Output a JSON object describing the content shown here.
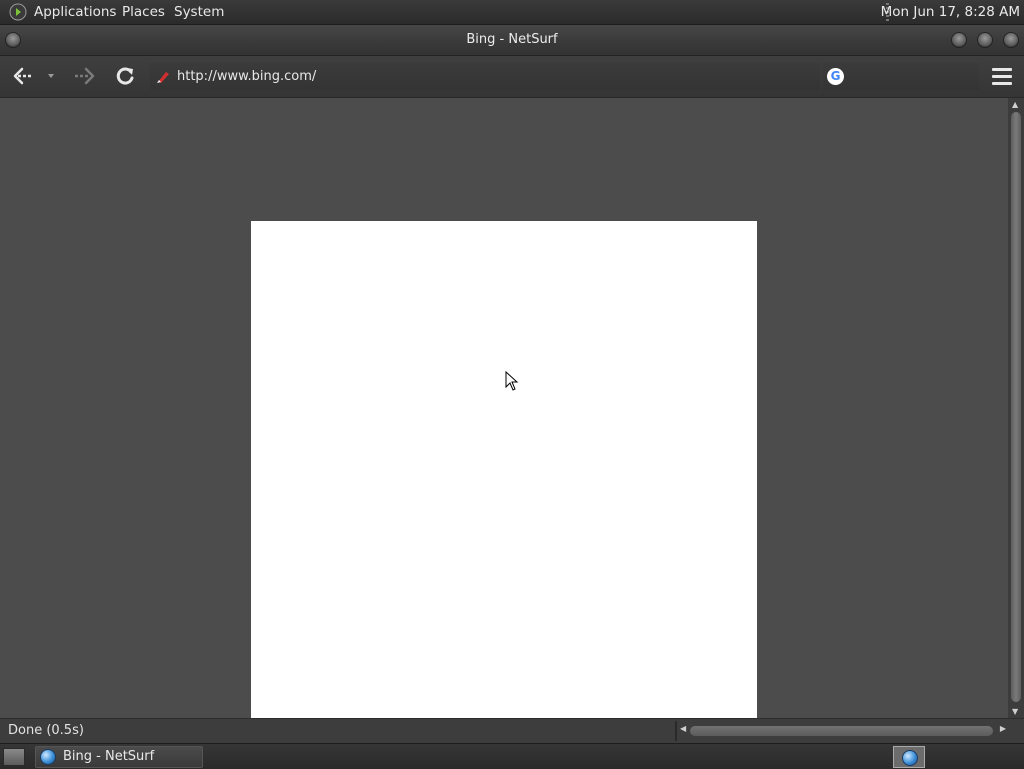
{
  "top_panel": {
    "menus": [
      "Applications",
      "Places",
      "System"
    ],
    "clock": "Mon Jun 17,  8:28 AM"
  },
  "window": {
    "title": "Bing - NetSurf"
  },
  "toolbar": {
    "url": "http://www.bing.com/",
    "search_placeholder": ""
  },
  "status": {
    "text": "Done (0.5s)"
  },
  "taskbar": {
    "items": [
      {
        "label": "Bing - NetSurf",
        "icon": "globe-icon"
      }
    ]
  },
  "colors": {
    "background": "#4b4b4b",
    "page": "#ffffff",
    "panel": "#2f2f2f"
  }
}
